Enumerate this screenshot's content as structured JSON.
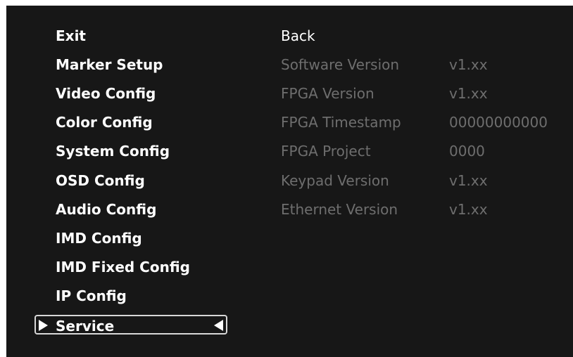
{
  "menu": {
    "items": [
      {
        "label": "Exit"
      },
      {
        "label": "Marker Setup"
      },
      {
        "label": "Video Config"
      },
      {
        "label": "Color Config"
      },
      {
        "label": "System Config"
      },
      {
        "label": "OSD Config"
      },
      {
        "label": "Audio Config"
      },
      {
        "label": "IMD Config"
      },
      {
        "label": "IMD Fixed Config"
      },
      {
        "label": "IP Config"
      },
      {
        "label": "Service",
        "selected": true
      }
    ]
  },
  "submenu": {
    "back_label": "Back",
    "rows": [
      {
        "label": "Software Version",
        "value": "v1.xx"
      },
      {
        "label": "FPGA Version",
        "value": "v1.xx"
      },
      {
        "label": "FPGA Timestamp",
        "value": "00000000000"
      },
      {
        "label": "FPGA Project",
        "value": "0000"
      },
      {
        "label": "Keypad Version",
        "value": "v1.xx"
      },
      {
        "label": "Ethernet Version",
        "value": "v1.xx"
      }
    ]
  },
  "colors": {
    "background": "#171717",
    "text": "#ffffff",
    "disabled_text": "#6e6e6e",
    "selection_border": "#d8d8d8"
  }
}
